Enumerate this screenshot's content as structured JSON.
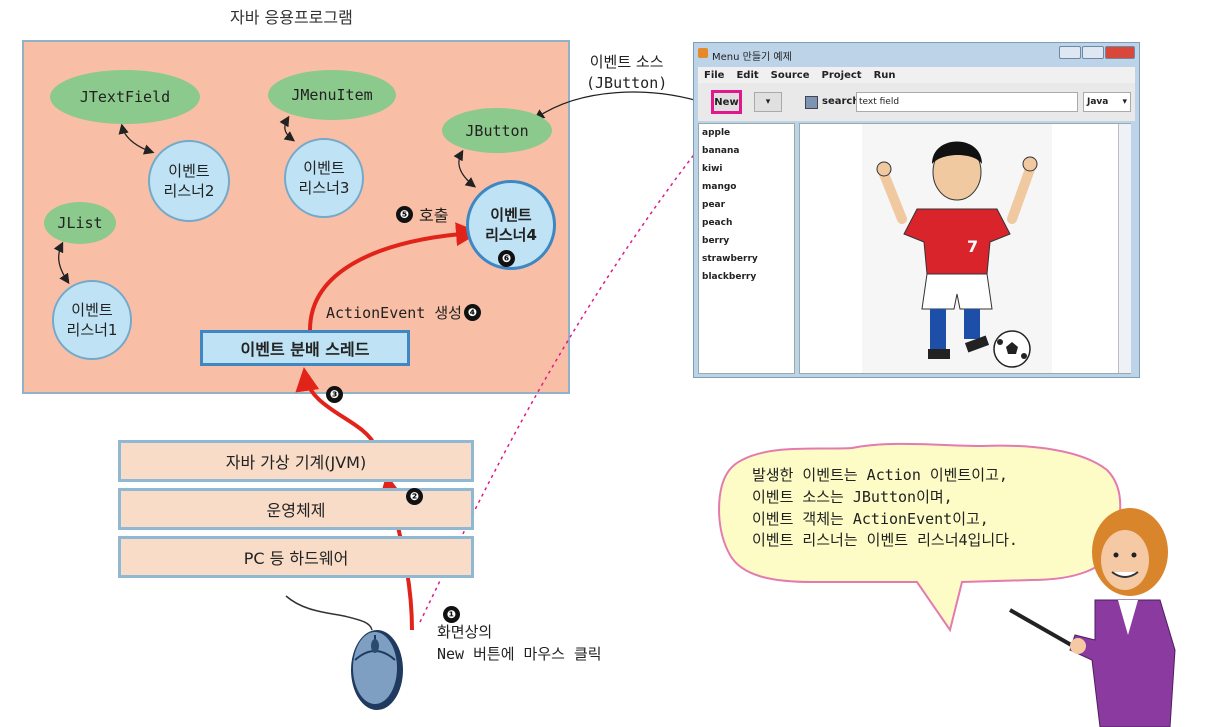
{
  "app_title": "자바 응용프로그램",
  "components": {
    "jtextfield": "JTextField",
    "jmenuitem": "JMenuItem",
    "jbutton": "JButton",
    "jlist": "JList"
  },
  "listeners": {
    "l1": [
      "이벤트",
      "리스너1"
    ],
    "l2": [
      "이벤트",
      "리스너2"
    ],
    "l3": [
      "이벤트",
      "리스너3"
    ],
    "l4": [
      "이벤트",
      "리스너4"
    ]
  },
  "event_dispatch": "이벤트 분배 스레드",
  "action_event": "ActionEvent 생성",
  "call_label": "호출",
  "layers": [
    "자바 가상 기계(JVM)",
    "운영체제",
    "PC 등 하드웨어"
  ],
  "mouse_caption": [
    "화면상의",
    "New 버튼에 마우스 클릭"
  ],
  "event_source": [
    "이벤트 소스",
    "(JButton)"
  ],
  "steps": [
    "❶",
    "❷",
    "❸",
    "❹",
    "❺",
    "❻"
  ],
  "window": {
    "title": "Menu 만들기 예제",
    "menu": [
      "File",
      "Edit",
      "Source",
      "Project",
      "Run"
    ],
    "new_button": "New",
    "search_label": "search",
    "text_field": "text field",
    "lang_select": "Java",
    "list_items": [
      "apple",
      "banana",
      "kiwi",
      "mango",
      "pear",
      "peach",
      "berry",
      "strawberry",
      "blackberry"
    ]
  },
  "bubble": [
    "발생한 이벤트는 Action 이벤트이고,",
    "이벤트 소스는 JButton이며,",
    "이벤트 객체는 ActionEvent이고,",
    "이벤트 리스너는 이벤트 리스너4입니다."
  ],
  "colors": {
    "app_bg": "#f8bfa6",
    "component": "#8cc98c",
    "listener": "#bfe3f4",
    "arrow": "#e2231a",
    "highlight": "#e0188c"
  }
}
